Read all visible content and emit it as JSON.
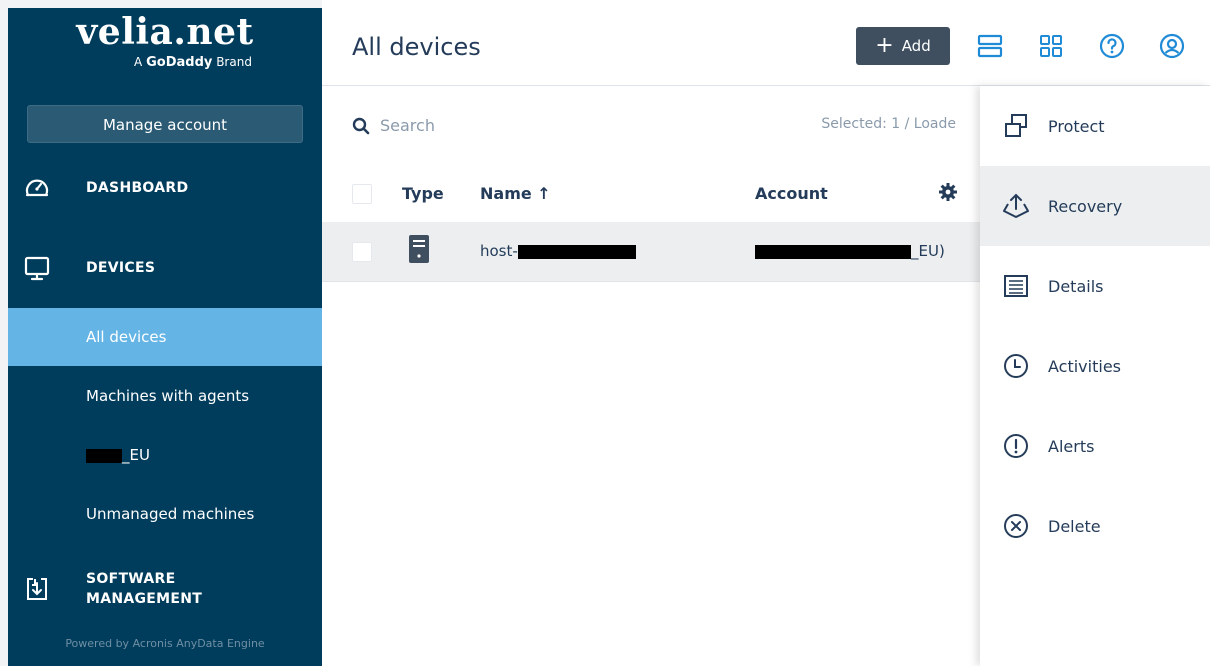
{
  "brand": {
    "logo_text": "velia.net",
    "tagline_prefix": "A",
    "tagline_brand": "GoDaddy",
    "tagline_suffix": "Brand"
  },
  "sidebar": {
    "manage_account_label": "Manage account",
    "sections": {
      "dashboard": "DASHBOARD",
      "devices": "DEVICES",
      "software_line1": "SOFTWARE",
      "software_line2": "MANAGEMENT"
    },
    "device_items": [
      {
        "label": "All devices",
        "active": true
      },
      {
        "label": "Machines with agents",
        "active": false
      },
      {
        "label": "_EU",
        "active": false,
        "redacted_prefix": true
      },
      {
        "label": "Unmanaged machines",
        "active": false
      }
    ],
    "powered_by": "Powered by Acronis AnyData Engine"
  },
  "header": {
    "title": "All devices",
    "add_label": "Add",
    "icons": [
      "list-view-icon",
      "grid-view-icon",
      "help-icon",
      "account-icon"
    ]
  },
  "main": {
    "search_placeholder": "Search",
    "selected_text": "Selected: 1 / Loade",
    "columns": {
      "type": "Type",
      "name": "Name ↑",
      "account": "Account"
    },
    "rows": [
      {
        "type_icon": "server-icon",
        "name_prefix": "host-",
        "account_suffix": "_EU)"
      }
    ]
  },
  "context_menu": {
    "items": [
      {
        "label": "Protect",
        "icon": "protect-icon",
        "hovered": false
      },
      {
        "label": "Recovery",
        "icon": "recovery-icon",
        "hovered": true
      },
      {
        "label": "Details",
        "icon": "details-icon",
        "hovered": false
      },
      {
        "label": "Activities",
        "icon": "activities-icon",
        "hovered": false
      },
      {
        "label": "Alerts",
        "icon": "alerts-icon",
        "hovered": false
      },
      {
        "label": "Delete",
        "icon": "delete-icon",
        "hovered": false
      }
    ]
  },
  "colors": {
    "sidebar_bg": "#003d5c",
    "active_item": "#64b5e6",
    "text_dark": "#243c59",
    "add_button": "#3f4f5f"
  }
}
